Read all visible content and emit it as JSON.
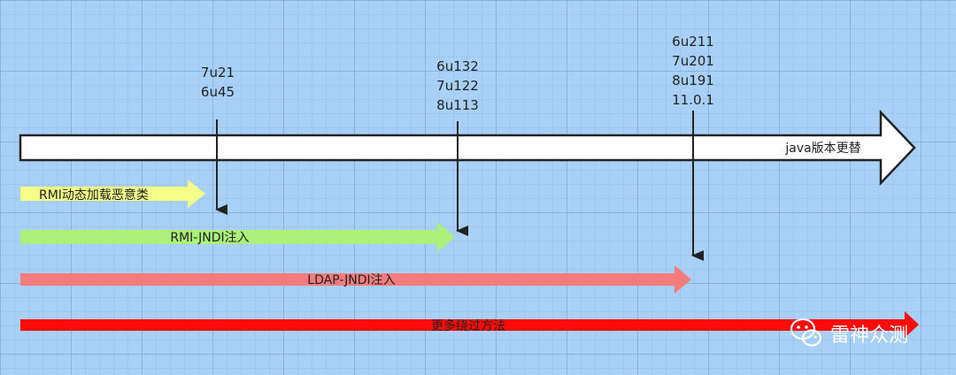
{
  "timeline": {
    "label": "java版本更替",
    "color": "#ffffff"
  },
  "versions": [
    {
      "lines": [
        "7u21",
        "6u45"
      ]
    },
    {
      "lines": [
        "6u132",
        "7u122",
        "8u113"
      ]
    },
    {
      "lines": [
        "6u211",
        "7u201",
        "8u191",
        "11.0.1"
      ]
    }
  ],
  "techniques": [
    {
      "label": "RMI动态加载恶意类",
      "color": "#f4ff8a"
    },
    {
      "label": "RMI-JNDI注入",
      "color": "#aaf07a"
    },
    {
      "label": "LDAP-JNDI注入",
      "color": "#f47c7c"
    },
    {
      "label": "更多绕过方法",
      "color": "#ff0a0a"
    }
  ],
  "watermark": {
    "text": "雷神众测",
    "icon": "wechat-icon"
  }
}
